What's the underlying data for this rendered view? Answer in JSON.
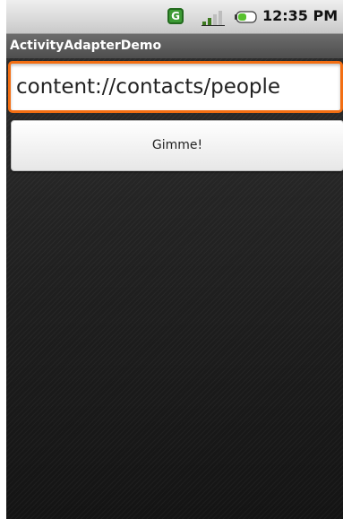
{
  "status_bar": {
    "time": "12:35 PM",
    "icons": [
      "gtalk-icon",
      "signal-icon",
      "battery-icon"
    ],
    "gtalk_glyph": "G"
  },
  "app": {
    "title": "ActivityAdapterDemo"
  },
  "url_field": {
    "value": "content://contacts/people"
  },
  "gimme_button": {
    "label": "Gimme!"
  },
  "colors": {
    "focus_accent": "#f36e12",
    "background": "#1e1e1e",
    "title_bar": "#5a5a5a"
  }
}
